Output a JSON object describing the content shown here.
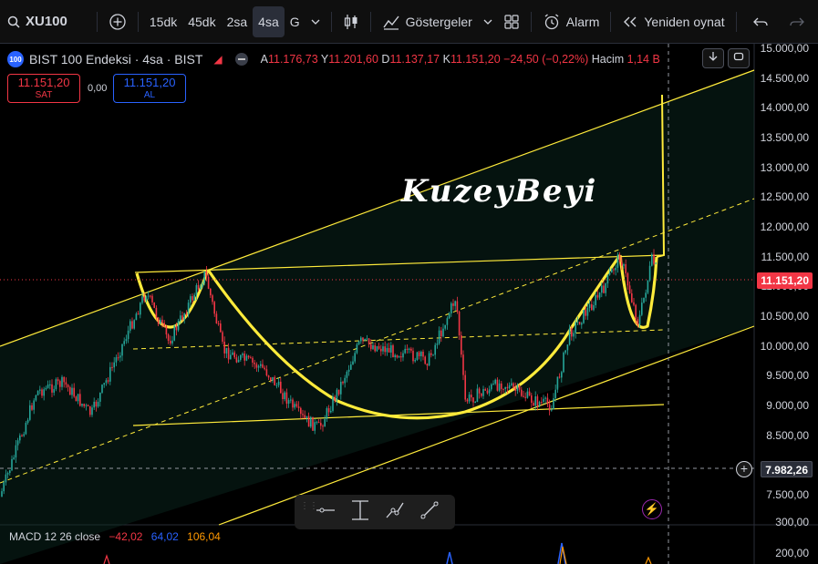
{
  "toolbar": {
    "symbol": "XU100",
    "intervals": [
      "15dk",
      "45dk",
      "2sa",
      "4sa",
      "G"
    ],
    "active_interval": "4sa",
    "indicators_label": "Göstergeler",
    "alarm_label": "Alarm",
    "replay_label": "Yeniden oynat"
  },
  "legend": {
    "badge": "100",
    "title": "BIST 100 Endeksi · 4sa · BIST",
    "open_label": "A",
    "open": "11.176,73",
    "high_label": "Y",
    "high": "11.201,60",
    "low_label": "D",
    "low": "11.137,17",
    "close_label": "K",
    "close": "11.151,20",
    "change": "−24,50 (−0,22%)",
    "volume_label": "Hacim",
    "volume": "1,14 B"
  },
  "trade": {
    "sell_price": "11.151,20",
    "sell_label": "SAT",
    "spread": "0,00",
    "buy_price": "11.151,20",
    "buy_label": "AL"
  },
  "price_axis": [
    "15.000,00",
    "14.500,00",
    "14.000,00",
    "13.500,00",
    "13.000,00",
    "12.500,00",
    "12.000,00",
    "11.500,00",
    "11.000,00",
    "10.500,00",
    "10.000,00",
    "9.500,00",
    "9.000,00",
    "8.500,00",
    "7.500,00"
  ],
  "current_price_tag": "11.151,20",
  "crosshair_price_tag": "7.982,26",
  "watermark": "KuzeyBeyi",
  "macd": {
    "label": "MACD 12 26 close",
    "v1": "−42,02",
    "v2": "64,02",
    "v3": "106,04",
    "axis": [
      "300,00",
      "200,00"
    ]
  },
  "colors": {
    "up": "#26a69a",
    "down": "#f23645",
    "drawing": "#ffeb3b",
    "accent": "#2962ff"
  }
}
